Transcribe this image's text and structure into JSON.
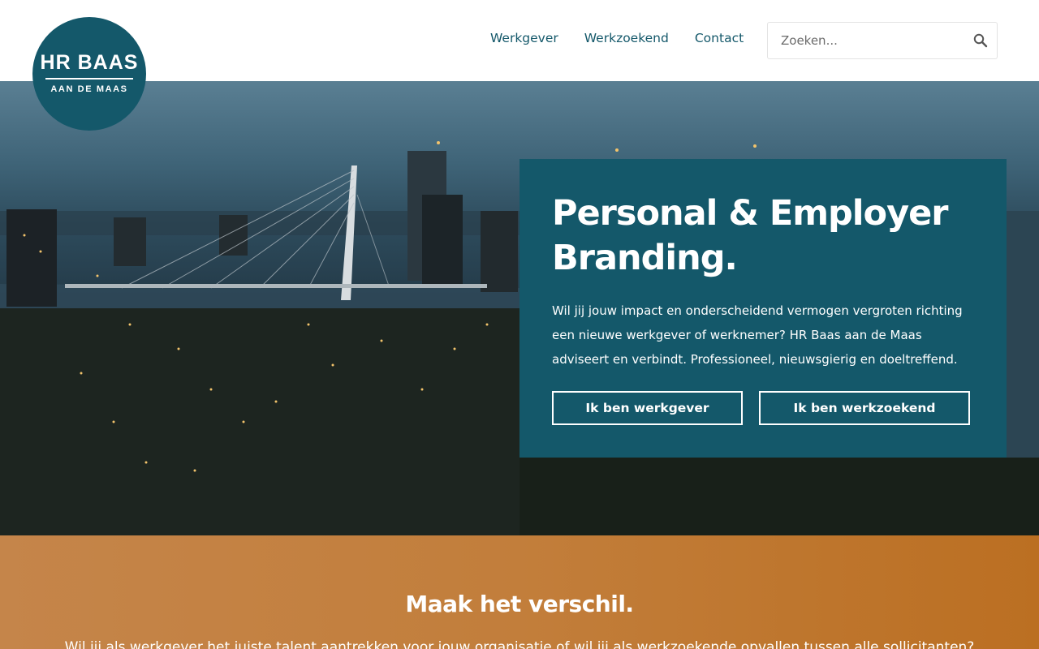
{
  "logo": {
    "main": "HR BAAS",
    "sub": "AAN DE MAAS"
  },
  "nav": {
    "items": [
      "Werkgever",
      "Werkzoekend",
      "Contact"
    ]
  },
  "search": {
    "placeholder": "Zoeken...",
    "icon": "search-icon"
  },
  "hero": {
    "title_line1": "Personal & Employer",
    "title_line2": "Branding.",
    "text_lead": "Wil jij jouw impact en onderscheidend vermogen vergroten richting een nieuwe werkgever of werknemer",
    "text_rest": "? HR Baas aan de Maas adviseert en verbindt. Professioneel, nieuwsgierig en doeltreffend.",
    "button_employer": "Ik ben werkgever",
    "button_seeker": "Ik ben werkzoekend"
  },
  "section": {
    "title": "Maak het verschil.",
    "text": "Wil jij als werkgever het juiste talent aantrekken voor jouw organisatie of wil jij als werkzoekende opvallen tussen alle sollicitanten?"
  },
  "colors": {
    "brand": "#14586a",
    "accent": "#c27e3b",
    "white": "#ffffff"
  }
}
